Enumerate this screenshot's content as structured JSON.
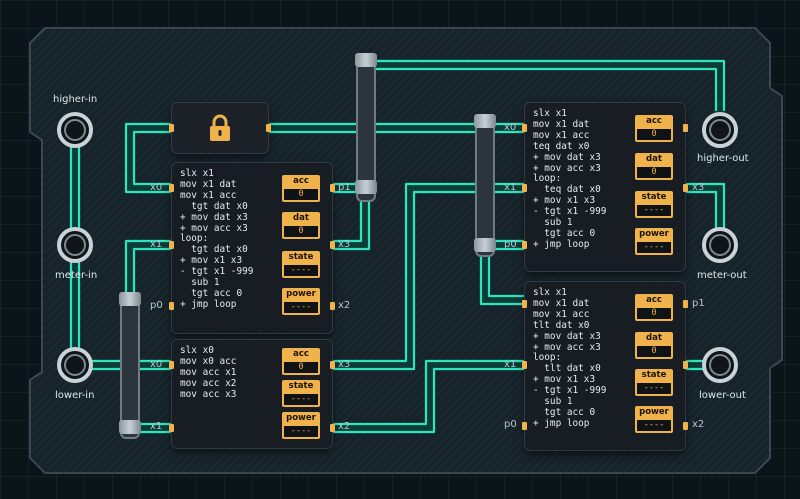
{
  "io": {
    "higher_in": "higher-in",
    "meter_in": "meter-in",
    "lower_in": "lower-in",
    "higher_out": "higher-out",
    "meter_out": "meter-out",
    "lower_out": "lower-out"
  },
  "chips": [
    {
      "code": "slx x1\nmov x1 dat\nmov x1 acc\n  tgt dat x0\n+ mov dat x3\n+ mov acc x3\nloop:\n  tgt dat x0\n+ mov x1 x3\n- tgt x1 -999\n  sub 1\n  tgt acc 0\n+ jmp loop",
      "acc": "0",
      "dat": "0",
      "state": "----",
      "power": "----",
      "ports": {
        "x0": "x0",
        "x1": "x1",
        "p0": "p0",
        "p1": "p1",
        "x3": "x3",
        "x2": "x2"
      }
    },
    {
      "code": "slx x0\nmov x0 acc\nmov acc x1\nmov acc x2\nmov acc x3",
      "acc": "0",
      "state": "----",
      "power": "----",
      "ports": {
        "x0": "x0",
        "x1": "x1",
        "x3": "x3",
        "x2": "x2"
      }
    },
    {
      "code": "slx x1\nmov x1 dat\nmov x1 acc\nteq dat x0\n+ mov dat x3\n+ mov acc x3\nloop:\n  teq dat x0\n+ mov x1 x3\n- tgt x1 -999\n  sub 1\n  tgt acc 0\n+ jmp loop",
      "acc": "0",
      "dat": "0",
      "state": "----",
      "power": "----",
      "ports": {
        "x0": "x0",
        "x1": "x1",
        "p0": "p0",
        "x3": "x3"
      }
    },
    {
      "code": "slx x1\nmov x1 dat\nmov x1 acc\ntlt dat x0\n+ mov dat x3\n+ mov acc x3\nloop:\n  tlt dat x0\n+ mov x1 x3\n- tgt x1 -999\n  sub 1\n  tgt acc 0\n+ jmp loop",
      "acc": "0",
      "dat": "0",
      "state": "----",
      "power": "----",
      "ports": {
        "x1": "x1",
        "p0": "p0",
        "p1": "p1",
        "x2": "x2"
      }
    }
  ],
  "registers": {
    "acc": "acc",
    "dat": "dat",
    "state": "state",
    "power": "power"
  },
  "colors": {
    "wire": "#2fe3c0",
    "register": "#f0b24a",
    "board": "#17232a"
  },
  "icons": {
    "lock": "padlock-icon"
  }
}
